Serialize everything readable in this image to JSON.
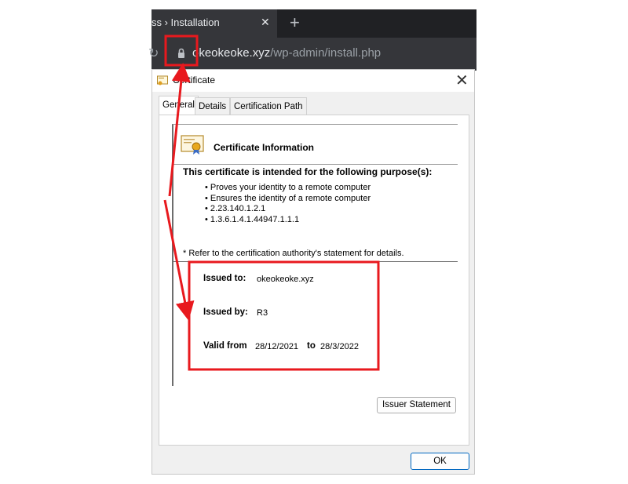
{
  "browser": {
    "tab_title": "ss › Installation",
    "tab_close_glyph": "✕",
    "new_tab_glyph": "+",
    "reload_glyph": "↻",
    "url_host": "okeokeoke.xyz",
    "url_path": "/wp-admin/install.php"
  },
  "dialog": {
    "title": "Certificate",
    "close_glyph": "✕",
    "tabs": [
      "General",
      "Details",
      "Certification Path"
    ],
    "active_tab": "General",
    "info_title": "Certificate Information",
    "purpose_heading": "This certificate is intended for the following purpose(s):",
    "purposes": [
      "• Proves your identity to a remote computer",
      "• Ensures the identity of a remote computer",
      "• 2.23.140.1.2.1",
      "• 1.3.6.1.4.1.44947.1.1.1"
    ],
    "refer_note": "* Refer to the certification authority's statement for details.",
    "issued_to_label": "Issued to:",
    "issued_to": "okeokeoke.xyz",
    "issued_by_label": "Issued by:",
    "issued_by": "R3",
    "valid_from_label": "Valid from",
    "valid_from": "28/12/2021",
    "to_label": "to",
    "valid_to": "28/3/2022",
    "issuer_statement_button": "Issuer Statement",
    "ok_button": "OK"
  },
  "colors": {
    "chrome_dark": "#202124",
    "chrome_tab": "#35363a",
    "annotation_red": "#e8191e",
    "ok_border": "#0067c0"
  },
  "icons": [
    "lock-icon",
    "certificate-icon",
    "close-icon",
    "reload-icon",
    "plus-icon"
  ]
}
